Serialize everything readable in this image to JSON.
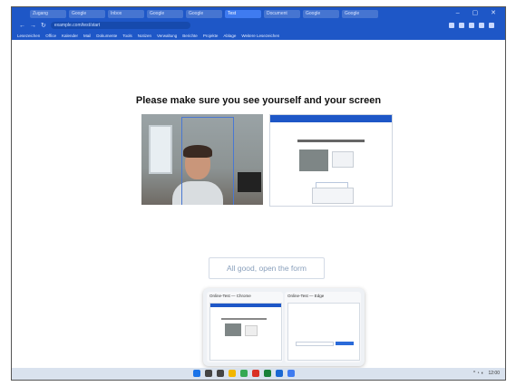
{
  "browser": {
    "tabs": [
      {
        "label": "Zugang"
      },
      {
        "label": "Google"
      },
      {
        "label": "Inbox"
      },
      {
        "label": "Google"
      },
      {
        "label": "Google"
      },
      {
        "label": "Test",
        "active": true
      },
      {
        "label": "Document"
      },
      {
        "label": "Google"
      },
      {
        "label": "Google"
      }
    ],
    "url": "example.com/test/start",
    "bookmarks": [
      "Lesezeichen",
      "Office",
      "Kalender",
      "Mail",
      "Dokumente",
      "Tools",
      "Notizen",
      "Verwaltung",
      "Berichte",
      "Projekte",
      "Ablage",
      "Weitere Lesezeichen"
    ]
  },
  "page": {
    "heading": "Please make sure you see yourself and your screen",
    "good_button": "All good, open the form"
  },
  "popup": {
    "windows": [
      {
        "title": "Online-Test — Chrome"
      },
      {
        "title": "Online-Test — Edge"
      }
    ]
  },
  "taskbar": {
    "icons": [
      {
        "name": "windows-start",
        "color": "#1a73e8"
      },
      {
        "name": "search",
        "color": "#444444"
      },
      {
        "name": "task-view",
        "color": "#444444"
      },
      {
        "name": "file-explorer",
        "color": "#f2b600"
      },
      {
        "name": "chrome",
        "color": "#34a853"
      },
      {
        "name": "app",
        "color": "#d93025"
      },
      {
        "name": "teams",
        "color": "#188038"
      },
      {
        "name": "outlook",
        "color": "#1967d2"
      },
      {
        "name": "settings",
        "color": "#3f7bf0"
      }
    ],
    "tray_time": "12:00"
  }
}
